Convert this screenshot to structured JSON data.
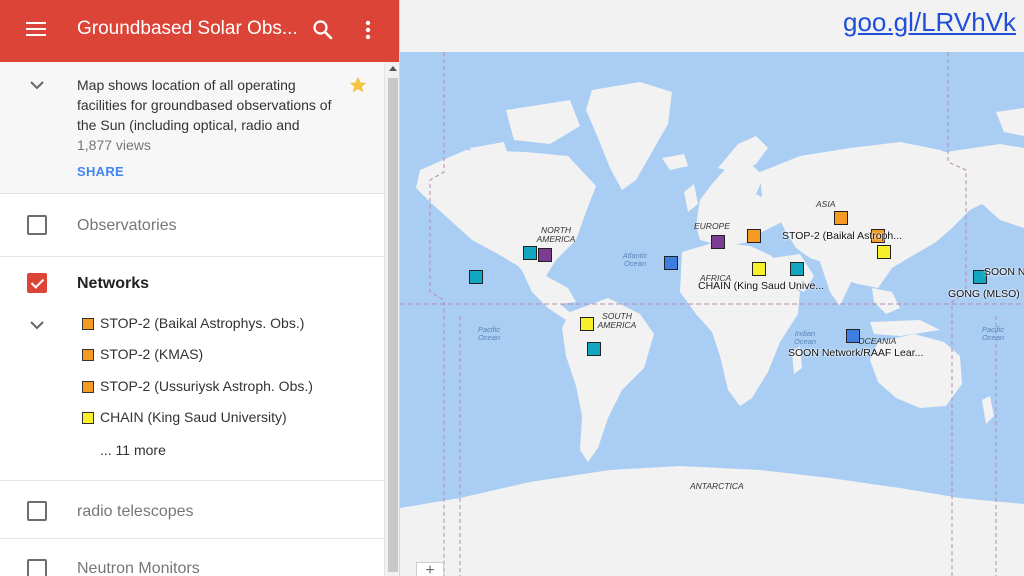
{
  "app": {
    "title": "Groundbased Solar Obs..."
  },
  "description": {
    "text": "Map shows location of all operating facilities for groundbased observations of the Sun (including optical, radio and",
    "views": "1,877 views",
    "share_label": "SHARE"
  },
  "layers": [
    {
      "label": "Observatories",
      "checked": false
    },
    {
      "label": "Networks",
      "checked": true
    },
    {
      "label": "radio telescopes",
      "checked": false
    },
    {
      "label": "Neutron Monitors",
      "checked": false
    }
  ],
  "networks": {
    "items": [
      {
        "label": "STOP-2 (Baikal Astrophys. Obs.)",
        "color": "#f59a23"
      },
      {
        "label": "STOP-2 (KMAS)",
        "color": "#f59a23"
      },
      {
        "label": "STOP-2 (Ussuriysk Astroph. Obs.)",
        "color": "#f59a23"
      },
      {
        "label": "CHAIN (King Saud University)",
        "color": "#f7ef2a"
      }
    ],
    "more_label": "... 11 more"
  },
  "shortlink": "goo.gl/LRVhVk",
  "map": {
    "zoom_in": "+",
    "regions": {
      "north_america": "NORTH AMERICA",
      "south_america": "SOUTH AMERICA",
      "europe": "EUROPE",
      "africa": "AFRICA",
      "asia": "ASIA",
      "oceania": "OCEANIA",
      "antarctica": "ANTARCTICA"
    },
    "oceans": {
      "atlantic": "Atlantic Ocean",
      "pacific_left": "Pacific Ocean",
      "indian": "Indian Ocean",
      "pacific_right": "Pacific Ocean"
    },
    "marker_labels": {
      "stop2_baikal": "STOP-2 (Baikal Astroph...",
      "chain_king_saud": "CHAIN (King Saud Unive...",
      "soon_raaf": "SOON Network/RAAF Lear...",
      "gong_mlso": "GONG (MLSO)",
      "soon_n": "SOON N"
    },
    "colors": {
      "orange": "#f59a23",
      "yellow": "#f7ef2a",
      "teal": "#13a6c0",
      "purple": "#7a3d92",
      "blue": "#3d7ee0"
    }
  }
}
